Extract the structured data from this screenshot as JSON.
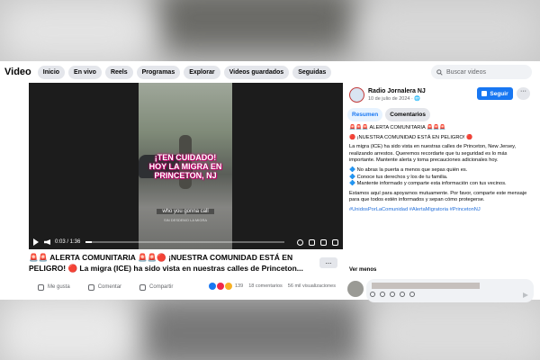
{
  "nav": {
    "title": "Video",
    "tabs": [
      "Inicio",
      "En vivo",
      "Reels",
      "Programas",
      "Explorar",
      "Videos guardados",
      "Seguidas"
    ],
    "search_placeholder": "Buscar videos"
  },
  "video": {
    "overlay_lines": [
      "¡TEN CUIDADO!",
      "HOY LA MIGRA EN",
      "PRINCETON, NJ"
    ],
    "caption": "who you gonna call",
    "caption_sub": "SIN DESDEMO LA MIGRA",
    "time": "0:03 / 1:36",
    "progress": 0.03
  },
  "post": {
    "title": "🚨🚨 ALERTA COMUNITARIA 🚨🚨🔴 ¡NUESTRA COMUNIDAD ESTÁ EN PELIGRO! 🔴 La migra (ICE) ha sido vista en nuestras calles de Princeton...",
    "more": "...",
    "like": "Me gusta",
    "comment": "Comentar",
    "share": "Compartir",
    "reactions": "139",
    "comments_count": "18 comentarios",
    "views": "56 mil visualizaciones"
  },
  "side": {
    "page_name": "Radio Jornalera NJ",
    "date": "10 de julio de 2024 · 🌐",
    "follow": "Seguir",
    "more": "···",
    "tabs": [
      "Resumen",
      "Comentarios"
    ],
    "paragraphs": [
      "🚨🚨🚨 ALERTA COMUNITARIA 🚨🚨🚨",
      "🔴 ¡NUESTRA COMUNIDAD ESTÁ EN PELIGRO! 🔴",
      "La migra (ICE) ha sido vista en nuestras calles de Princeton, New Jersey, realizando arrestos. Queremos recordarte que tu seguridad es lo más importante. Mantente alerta y toma precauciones adicionales hoy.",
      "🔷 No abras la puerta a menos que sepas quién es.\n🔷 Conoce tus derechos y los de tu familia.\n🔷 Mantente informado y comparte esta información con tus vecinos.",
      "Estamos aquí para apoyarnos mutuamente. Por favor, comparte este mensaje para que todos estén informados y sepan cómo protegerse."
    ],
    "hashtags": "#UnidosPorLaComunidad #AlertaMigratoria #PrincetonNJ",
    "ver_menos": "Ver menos"
  },
  "colors": {
    "accent": "#1877f2",
    "bg": "#ffffff"
  }
}
